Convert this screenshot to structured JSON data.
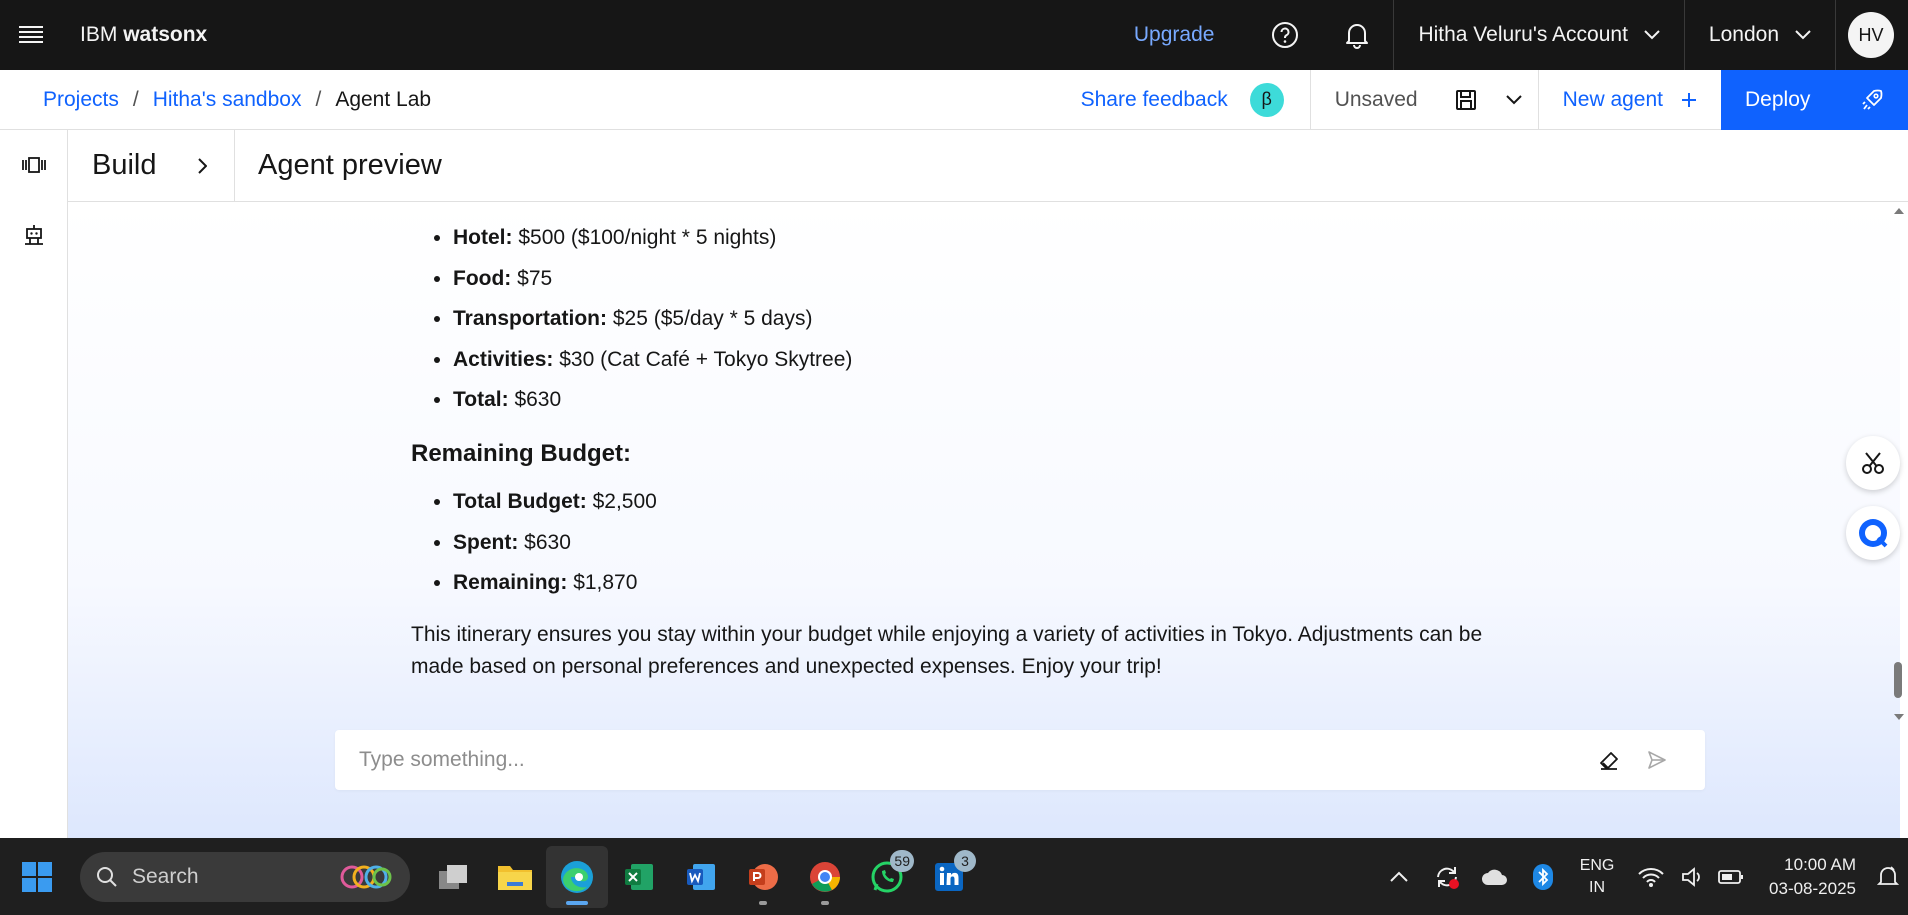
{
  "topbar": {
    "brand_prefix": "IBM",
    "brand_name": "watsonx",
    "upgrade": "Upgrade",
    "account": "Hitha Veluru's Account",
    "region": "London",
    "avatar_initials": "HV"
  },
  "subheader": {
    "breadcrumb": [
      "Projects",
      "Hitha's sandbox",
      "Agent Lab"
    ],
    "breadcrumb_sep": "/",
    "share_feedback": "Share feedback",
    "beta": "β",
    "unsaved": "Unsaved",
    "new_agent": "New agent",
    "deploy": "Deploy"
  },
  "panel": {
    "build": "Build",
    "title": "Agent preview"
  },
  "chat": {
    "expense_items": [
      {
        "label": "Hotel:",
        "value": "$500 ($100/night * 5 nights)"
      },
      {
        "label": "Food:",
        "value": "$75"
      },
      {
        "label": "Transportation:",
        "value": "$25 ($5/day * 5 days)"
      },
      {
        "label": "Activities:",
        "value": "$30 (Cat Café + Tokyo Skytree)"
      },
      {
        "label": "Total:",
        "value": "$630"
      }
    ],
    "budget_heading": "Remaining Budget:",
    "budget_items": [
      {
        "label": "Total Budget:",
        "value": "$2,500"
      },
      {
        "label": "Spent:",
        "value": "$630"
      },
      {
        "label": "Remaining:",
        "value": "$1,870"
      }
    ],
    "closing": "This itinerary ensures you stay within your budget while enjoying a variety of activities in Tokyo. Adjustments can be made based on personal preferences and unexpected expenses. Enjoy your trip!",
    "input_placeholder": "Type something..."
  },
  "taskbar": {
    "search_label": "Search",
    "whatsapp_badge": "59",
    "linkedin_badge": "3",
    "lang_line1": "ENG",
    "lang_line2": "IN",
    "time": "10:00 AM",
    "date": "03-08-2025"
  },
  "colors": {
    "topbar_bg": "#161616",
    "primary_blue": "#0f62fe",
    "link_blue": "#78a9ff",
    "beta_teal": "#3ddbd9"
  }
}
